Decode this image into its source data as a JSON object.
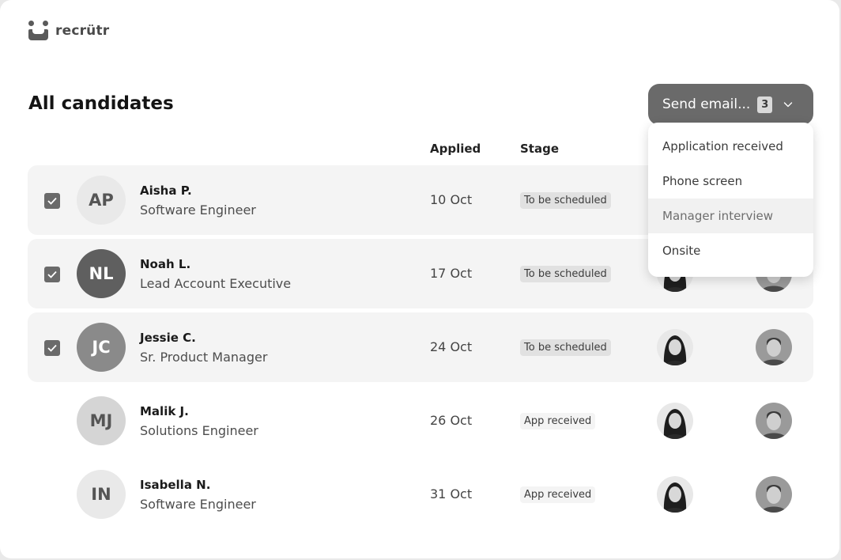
{
  "app": {
    "name": "recrütr"
  },
  "page": {
    "title": "All candidates"
  },
  "send_email": {
    "label": "Send email...",
    "count": "3"
  },
  "columns": {
    "applied": "Applied",
    "stage": "Stage"
  },
  "dropdown": {
    "items": [
      "Application received",
      "Phone screen",
      "Manager interview",
      "Onsite"
    ],
    "highlighted": "Manager interview"
  },
  "candidates": [
    {
      "initials": "AP",
      "name": "Aisha P.",
      "role": "Software Engineer",
      "applied": "10 Oct",
      "stage": "To be scheduled",
      "selected": true
    },
    {
      "initials": "NL",
      "name": "Noah L.",
      "role": "Lead Account Executive",
      "applied": "17 Oct",
      "stage": "To be scheduled",
      "selected": true
    },
    {
      "initials": "JC",
      "name": "Jessie C.",
      "role": "Sr. Product Manager",
      "applied": "24 Oct",
      "stage": "To be scheduled",
      "selected": true
    },
    {
      "initials": "MJ",
      "name": "Malik J.",
      "role": "Solutions Engineer",
      "applied": "26 Oct",
      "stage": "App received",
      "selected": false
    },
    {
      "initials": "IN",
      "name": "Isabella N.",
      "role": "Software Engineer",
      "applied": "31 Oct",
      "stage": "App received",
      "selected": false
    }
  ],
  "icons": {
    "checkbox": "checkmark-icon",
    "dropdown": "chevron-down-icon",
    "interviewer_a": "woman-portrait",
    "interviewer_b": "man-portrait"
  },
  "colors": {
    "button": "#6a6a6a",
    "selected_row": "#f4f4f4",
    "stage_badge": "#e1e1e1"
  }
}
